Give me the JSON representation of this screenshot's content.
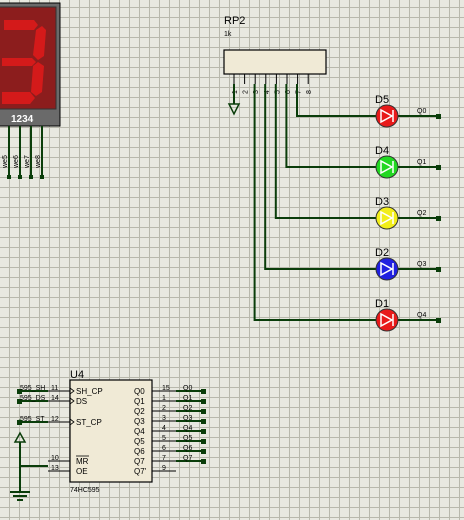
{
  "display": {
    "digits_label": "1234",
    "pins": [
      "we5",
      "we6",
      "we7",
      "we8"
    ]
  },
  "rp2": {
    "ref": "RP2",
    "value": "1k",
    "pins": [
      "1",
      "2",
      "3",
      "4",
      "5",
      "6",
      "7",
      "8"
    ]
  },
  "leds": [
    {
      "ref": "D5",
      "net": "Q0",
      "color": "#e81a1a"
    },
    {
      "ref": "D4",
      "net": "Q1",
      "color": "#22d822"
    },
    {
      "ref": "D3",
      "net": "Q2",
      "color": "#f2ee1a"
    },
    {
      "ref": "D2",
      "net": "Q3",
      "color": "#2020e0"
    },
    {
      "ref": "D1",
      "net": "Q4",
      "color": "#e81a1a"
    }
  ],
  "u4": {
    "ref": "U4",
    "part": "74HC595",
    "left_pins": [
      {
        "num": "11",
        "name": "SH_CP",
        "net": "595_SH"
      },
      {
        "num": "14",
        "name": "DS",
        "net": "595_DS"
      },
      {
        "num": "12",
        "name": "ST_CP",
        "net": "595_ST"
      },
      {
        "num": "10",
        "name": "MR",
        "net": ""
      },
      {
        "num": "13",
        "name": "OE",
        "net": ""
      }
    ],
    "right_pins": [
      {
        "num": "15",
        "name": "Q0",
        "net": "Q0"
      },
      {
        "num": "1",
        "name": "Q1",
        "net": "Q1"
      },
      {
        "num": "2",
        "name": "Q2",
        "net": "Q2"
      },
      {
        "num": "3",
        "name": "Q3",
        "net": "Q3"
      },
      {
        "num": "4",
        "name": "Q4",
        "net": "Q4"
      },
      {
        "num": "5",
        "name": "Q5",
        "net": "Q5"
      },
      {
        "num": "6",
        "name": "Q6",
        "net": "Q6"
      },
      {
        "num": "7",
        "name": "Q7",
        "net": "Q7"
      },
      {
        "num": "9",
        "name": "Q7'",
        "net": ""
      }
    ]
  }
}
